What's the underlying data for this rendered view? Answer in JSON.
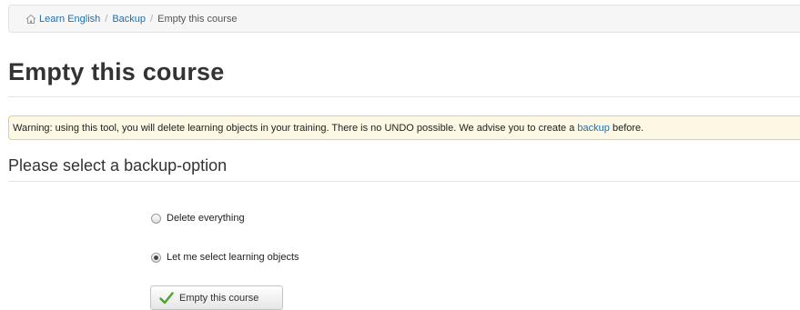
{
  "breadcrumb": {
    "items": [
      {
        "label": "Learn English"
      },
      {
        "label": "Backup"
      }
    ],
    "separator": "/",
    "current": "Empty this course"
  },
  "page": {
    "title": "Empty this course"
  },
  "warning": {
    "text_before": "Warning: using this tool, you will delete learning objects in your training. There is no UNDO possible. We advise you to create a",
    "link_label": "backup",
    "text_after": "before."
  },
  "section": {
    "title": "Please select a backup-option"
  },
  "options": [
    {
      "label": "Delete everything",
      "selected": false
    },
    {
      "label": "Let me select learning objects",
      "selected": true
    }
  ],
  "submit": {
    "label": "Empty this course",
    "icon": "check-icon",
    "icon_color": "#4aa52e"
  },
  "colors": {
    "link": "#1f6fae",
    "warning_bg": "#fcf8e3",
    "warning_border": "#e8cf7a"
  }
}
